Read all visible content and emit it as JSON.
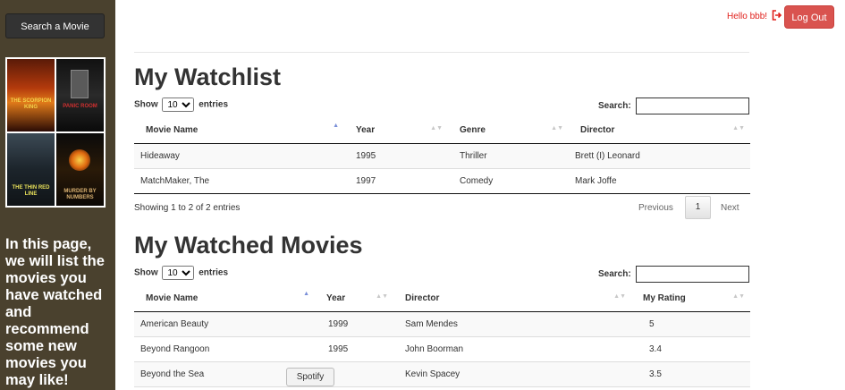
{
  "sidebar": {
    "search_button": "Search a Movie",
    "posters": [
      {
        "title": "THE SCORPION KING"
      },
      {
        "title": "PANIC ROOM"
      },
      {
        "title": "THE THIN RED LINE"
      },
      {
        "title": "MURDER BY NUMBERS"
      }
    ],
    "description": "In this page, we will list the movies you have watched and recommend some new movies you may like!"
  },
  "header": {
    "greeting": "Hello bbb!",
    "logout_label": "Log Out"
  },
  "watchlist": {
    "title": "My Watchlist",
    "show_label": "Show",
    "entries_label": "entries",
    "page_length": "10",
    "search_label": "Search:",
    "columns": [
      "Movie Name",
      "Year",
      "Genre",
      "Director"
    ],
    "rows": [
      [
        "Hideaway",
        "1995",
        "Thriller",
        "Brett (I) Leonard"
      ],
      [
        "MatchMaker, The",
        "1997",
        "Comedy",
        "Mark Joffe"
      ]
    ],
    "info": "Showing 1 to 2 of 2 entries",
    "pagination": {
      "previous": "Previous",
      "current": "1",
      "next": "Next"
    }
  },
  "watched": {
    "title": "My Watched Movies",
    "show_label": "Show",
    "entries_label": "entries",
    "page_length": "10",
    "search_label": "Search:",
    "columns": [
      "Movie Name",
      "Year",
      "Director",
      "My Rating"
    ],
    "rows": [
      [
        "American Beauty",
        "1999",
        "Sam Mendes",
        "5"
      ],
      [
        "Beyond Rangoon",
        "1995",
        "John Boorman",
        "3.4"
      ],
      [
        "Beyond the Sea",
        "",
        "Kevin Spacey",
        "3.5"
      ]
    ]
  },
  "tooltip": "Spotify",
  "colors": {
    "sidebar": "#4a412e",
    "logout": "#d9534f",
    "greeting": "#e0201b"
  }
}
